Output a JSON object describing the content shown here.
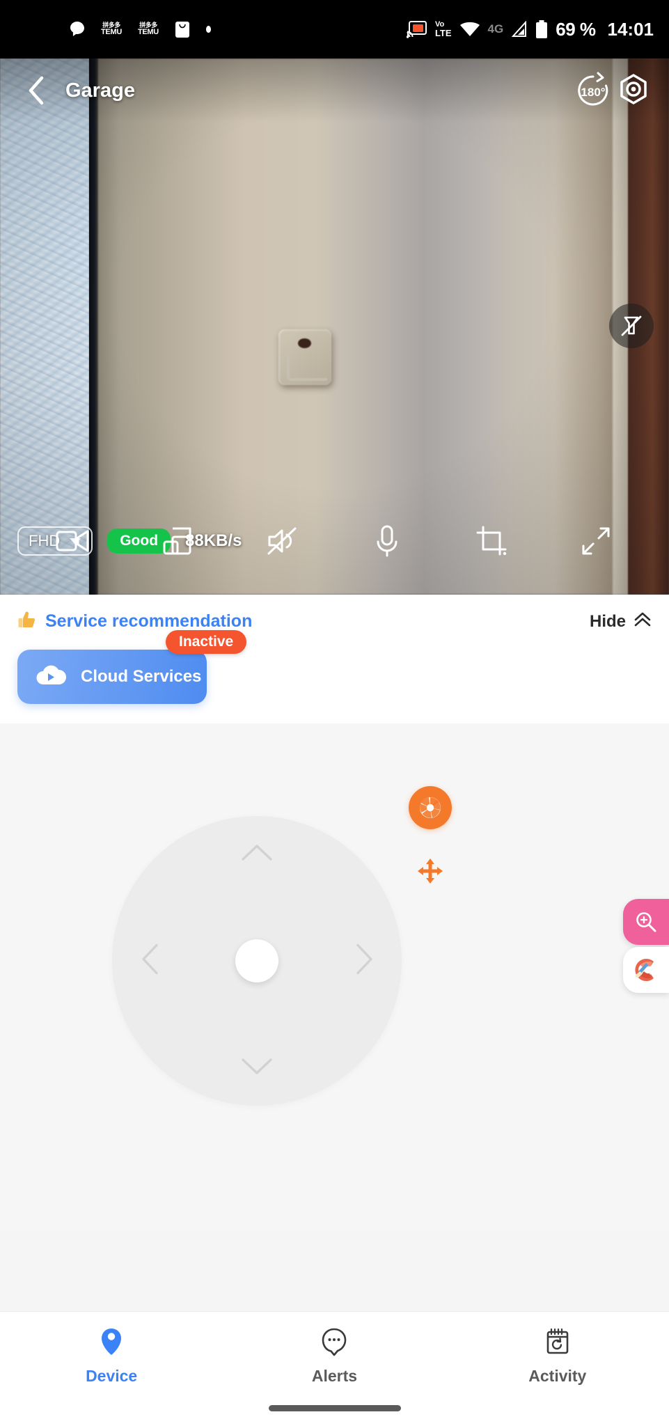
{
  "status_bar": {
    "left_icons": [
      {
        "name": "message-bubble-icon",
        "label": ""
      },
      {
        "name": "temu-notification-icon",
        "label_top": "TEMU",
        "label_bottom": "TEMU"
      },
      {
        "name": "temu-notification-icon-2",
        "label_top": "TEMU",
        "label_bottom": "TEMU"
      },
      {
        "name": "shopping-bag-icon",
        "label": ""
      },
      {
        "name": "generic-dot-icon",
        "label": ""
      }
    ],
    "temu_label": "TEMU",
    "temu_top_label": "拼多多",
    "volte_top": "Vo",
    "volte_bottom": "LTE",
    "network": "4G",
    "battery": "69 %",
    "time": "14:01"
  },
  "video": {
    "title": "Garage",
    "back_icon": "chevron-left-icon",
    "rotate_label": "180",
    "rotate_degree": "°",
    "settings_icon": "hexagon-settings-icon",
    "light_icon": "spotlight-off-icon",
    "resolution": "FHD",
    "quality": "Good",
    "bitrate": "88KB/s",
    "toolbar": [
      {
        "name": "record-video-icon",
        "label": "Record"
      },
      {
        "name": "multiscreen-icon",
        "label": "Multi-screen"
      },
      {
        "name": "speaker-muted-icon",
        "label": "Sound"
      },
      {
        "name": "microphone-icon",
        "label": "Talk"
      },
      {
        "name": "screenshot-crop-icon",
        "label": "Screenshot"
      },
      {
        "name": "fullscreen-expand-icon",
        "label": "Fullscreen"
      }
    ]
  },
  "service": {
    "thumbs_up_icon": "thumbs-up-icon",
    "title": "Service recommendation",
    "hide_label": "Hide",
    "hide_icon": "double-chevron-up-icon",
    "cards": [
      {
        "name": "cloud-services-card",
        "label": "Cloud Services",
        "badge": "Inactive",
        "icon": "cloud-play-icon",
        "color": "#4f8cf0",
        "badge_color": "#f4552f"
      }
    ]
  },
  "controls": {
    "dpad": {
      "up_icon": "chevron-up-icon",
      "down_icon": "chevron-down-icon",
      "left_icon": "chevron-left-icon",
      "right_icon": "chevron-right-icon",
      "center_icon": "dpad-center-button"
    },
    "shutter": {
      "icon": "camera-aperture-icon",
      "color": "#f5792b"
    },
    "pan": {
      "icon": "four-way-move-icon",
      "color": "#f5792b"
    },
    "floating": [
      {
        "name": "zoom-in-floating-button",
        "icon": "magnifier-plus-icon",
        "color": "#f0609a"
      },
      {
        "name": "ccleaner-floating-button",
        "icon": "ccleaner-logo-icon",
        "color": "#ffffff"
      }
    ]
  },
  "bottom_nav": {
    "items": [
      {
        "label": "Device",
        "icon": "device-camera-icon",
        "active": true
      },
      {
        "label": "Alerts",
        "icon": "alert-bubble-icon",
        "active": false
      },
      {
        "label": "Activity",
        "icon": "calendar-history-icon",
        "active": false
      }
    ],
    "active_color": "#3b82f6",
    "inactive_color": "#5a5a5a"
  }
}
